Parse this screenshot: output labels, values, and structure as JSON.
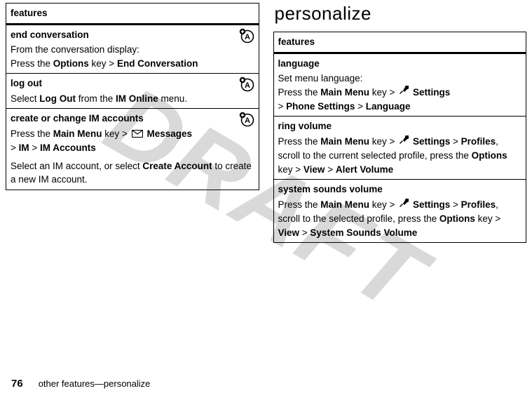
{
  "watermark": "DRAFT",
  "left": {
    "header": "features",
    "rows": [
      {
        "title": "end conversation",
        "desc_pre": "From the conversation display:",
        "press_pre": "Press the ",
        "press_key": "Options",
        "press_mid": " key > ",
        "press_target": "End Conversation"
      },
      {
        "title": "log out",
        "select_pre": "Select ",
        "select_item": "Log Out",
        "select_mid": " from the ",
        "select_menu": "IM Online",
        "select_post": " menu."
      },
      {
        "title": "create or change IM accounts",
        "press_pre": "Press the ",
        "press_key": "Main Menu",
        "press_mid": " key > ",
        "target1": "Messages",
        "sep": " > ",
        "target2": "IM",
        "target3": "IM Accounts",
        "desc_post_pre": "Select an IM account, or select ",
        "desc_post_bold": "Create Account",
        "desc_post_end": " to create a new IM account."
      }
    ]
  },
  "right": {
    "page_title": "personalize",
    "header": "features",
    "rows": [
      {
        "title": "language",
        "desc": "Set menu language:",
        "press_pre": "Press the ",
        "press_key": "Main Menu",
        "press_mid": " key > ",
        "target1": "Settings",
        "sep": " > ",
        "target2": "Phone Settings",
        "target3": "Language"
      },
      {
        "title": "ring volume",
        "press_pre": "Press the ",
        "press_key": "Main Menu",
        "press_mid": " key > ",
        "target1": "Settings",
        "sep": " > ",
        "target2": "Profiles",
        "desc2_pre": ", scroll to the current selected profile, press the ",
        "press_key2": "Options",
        "press_mid2": " key > ",
        "target3": "View",
        "target4": "Alert Volume"
      },
      {
        "title": "system sounds volume",
        "press_pre": "Press the ",
        "press_key": "Main Menu",
        "press_mid": " key > ",
        "target1": "Settings",
        "sep": " > ",
        "target2": "Profiles",
        "desc2_pre": ", scroll to the selected profile, press the ",
        "press_key2": "Options",
        "press_mid2": " key > ",
        "target3": "View",
        "target4": "System Sounds Volume"
      }
    ]
  },
  "footer": {
    "page": "76",
    "text": "other features—personalize"
  }
}
